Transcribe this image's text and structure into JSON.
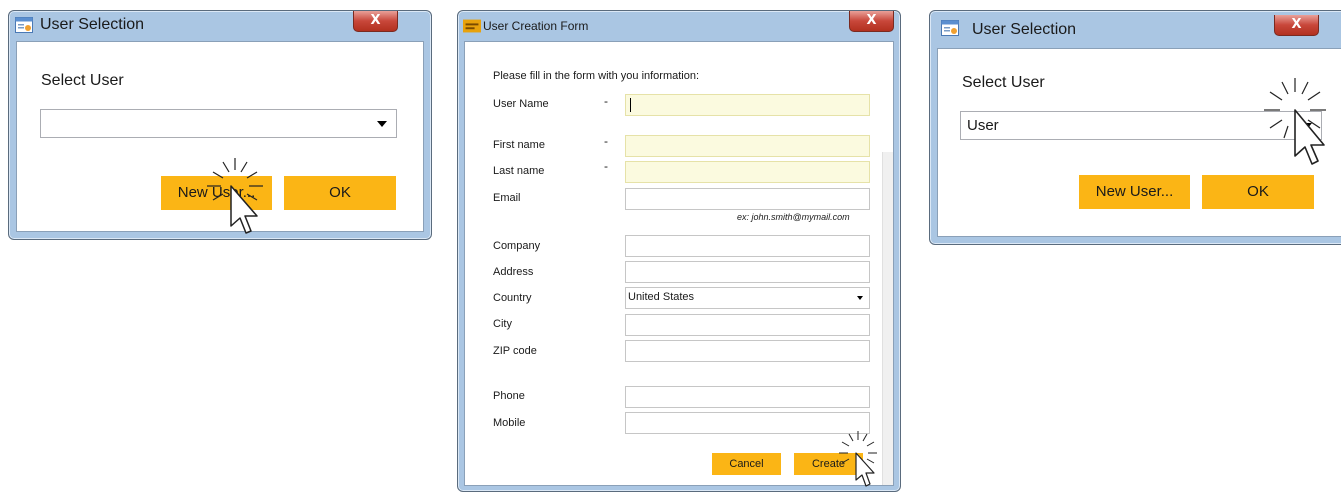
{
  "dialog1": {
    "title": "User Selection",
    "close": "X",
    "select_label": "Select User",
    "combo_value": "",
    "new_user_button": "New User...",
    "ok_button": "OK"
  },
  "form": {
    "title": "User Creation Form",
    "close": "X",
    "intro": "Please fill in the form with you information:",
    "fields": {
      "username": "User Name",
      "firstname": "First name",
      "lastname": "Last name",
      "email": "Email",
      "email_hint": "ex: john.smith@mymail.com",
      "company": "Company",
      "address": "Address",
      "country": "Country",
      "country_value": "United States",
      "city": "City",
      "zip": "ZIP code",
      "phone": "Phone",
      "mobile": "Mobile"
    },
    "required_mark": "-",
    "cancel_button": "Cancel",
    "create_button": "Create"
  },
  "dialog2": {
    "title": "User Selection",
    "close": "X",
    "select_label": "Select User",
    "combo_value": "User",
    "new_user_button": "New User...",
    "ok_button": "OK"
  },
  "colors": {
    "accent": "#fbb515",
    "window_frame": "#aac6e3",
    "close": "#c8473a",
    "required_field": "#fbfadf"
  },
  "icons": [
    "app-window-icon",
    "form-app-icon",
    "close-icon",
    "dropdown-arrow-icon",
    "cursor-click-icon"
  ]
}
